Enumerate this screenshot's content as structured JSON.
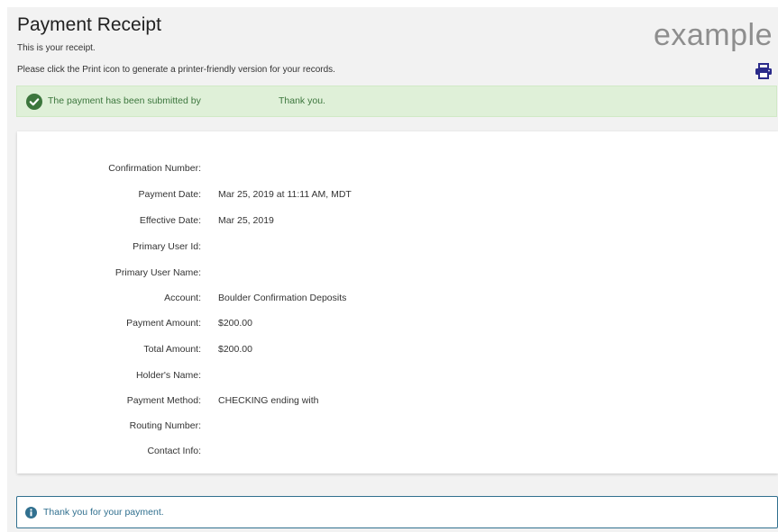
{
  "header": {
    "title": "Payment Receipt",
    "subtitle": "This is your receipt.",
    "instructions": "Please click the Print icon to generate a printer-friendly version for your records.",
    "watermark": "example",
    "print_icon": "print-icon"
  },
  "success_alert": {
    "message": "The payment has been submitted by",
    "thanks": "Thank you.",
    "icon": "check-circle-icon",
    "color": "#3c763d"
  },
  "receipt": {
    "rows": [
      {
        "label": "Confirmation Number:",
        "value": ""
      },
      {
        "label": "Payment Date:",
        "value": "Mar 25, 2019 at 11:11 AM, MDT"
      },
      {
        "label": "Effective Date:",
        "value": "Mar 25, 2019"
      },
      {
        "label": "Primary User Id:",
        "value": ""
      },
      {
        "label": "Primary User Name:",
        "value": ""
      },
      {
        "label": "Account:",
        "value": "Boulder Confirmation Deposits"
      },
      {
        "label": "Payment Amount:",
        "value": "$200.00"
      },
      {
        "label": "Total Amount:",
        "value": "$200.00"
      },
      {
        "label": "Holder's Name:",
        "value": ""
      },
      {
        "label": "Payment Method:",
        "value": "CHECKING ending with"
      },
      {
        "label": "Routing Number:",
        "value": ""
      },
      {
        "label": "Contact Info:",
        "value": ""
      }
    ]
  },
  "info_alert": {
    "message": "Thank you for your payment.",
    "icon": "info-circle-icon",
    "color": "#31708f"
  },
  "colors": {
    "accent": "#2a2a8a",
    "success_bg": "#dff0d8",
    "page_bg": "#f2f2f2"
  }
}
